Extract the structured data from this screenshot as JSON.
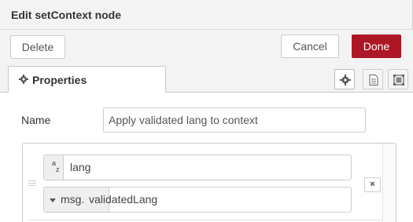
{
  "dialog": {
    "title": "Edit setContext node"
  },
  "toolbar": {
    "delete_label": "Delete",
    "cancel_label": "Cancel",
    "done_label": "Done",
    "done_color": "#ad1625"
  },
  "tabs": [
    {
      "label": "Properties",
      "icon": "gear-icon",
      "active": true
    }
  ],
  "tab_icons": [
    "settings-gear-icon",
    "description-doc-icon",
    "appearance-frame-icon"
  ],
  "form": {
    "name_label": "Name",
    "name_value": "Apply validated lang to context"
  },
  "rules": [
    {
      "field": {
        "type_label": "az",
        "type_icon": "string-type-icon",
        "value": "lang"
      },
      "source": {
        "type_label": "msg.",
        "value": "validatedLang"
      },
      "remove_label": "×"
    }
  ]
}
